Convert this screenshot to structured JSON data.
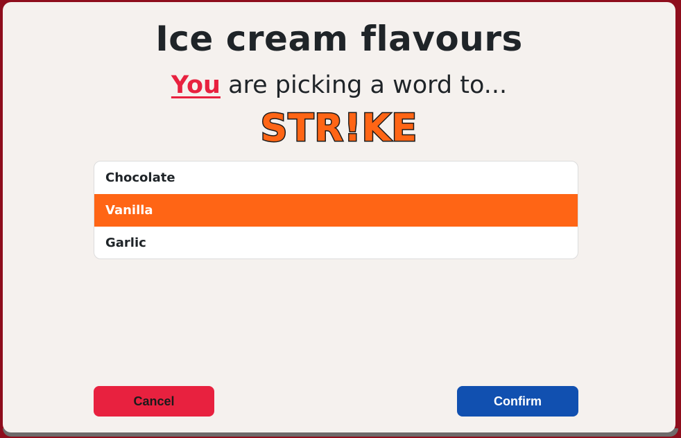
{
  "dialog": {
    "title": "Ice cream flavours",
    "subtitle_you": "You",
    "subtitle_rest": " are picking a word to...",
    "logo_text": "STR!KE"
  },
  "options": [
    {
      "label": "Chocolate",
      "selected": false
    },
    {
      "label": "Vanilla",
      "selected": true
    },
    {
      "label": "Garlic",
      "selected": false
    }
  ],
  "buttons": {
    "cancel_label": "Cancel",
    "confirm_label": "Confirm"
  },
  "colors": {
    "accent_orange": "#ff6515",
    "cancel_red": "#e8213f",
    "confirm_blue": "#1150b0",
    "frame_red": "#8e0d1c"
  }
}
